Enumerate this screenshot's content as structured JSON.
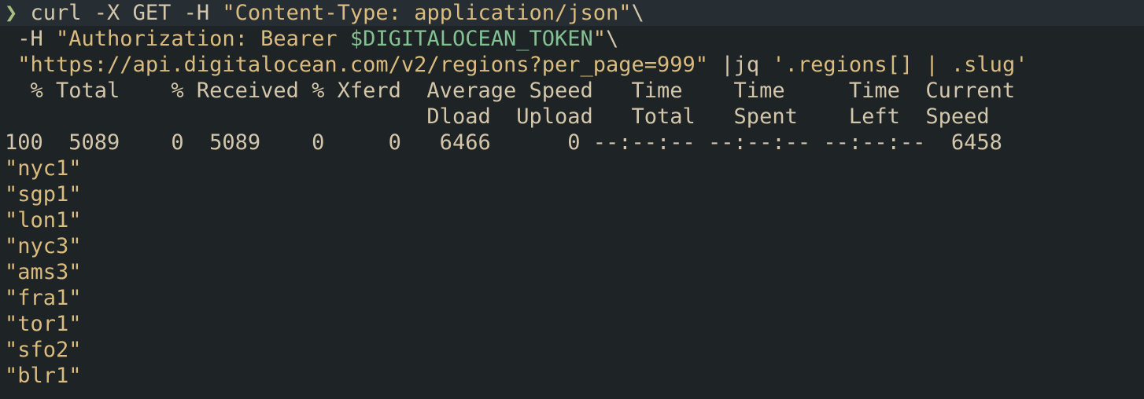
{
  "colors": {
    "background": "#1e2326",
    "command_highlight": "#272e33",
    "prompt": "#a7c080",
    "text": "#d3c6aa",
    "string": "#dbbc7f",
    "variable": "#83c092"
  },
  "command": {
    "prompt_symbol": "❯",
    "line1": {
      "cmd": " curl -X GET -H ",
      "str": "\"Content-Type: application/json\"",
      "tail": "\\"
    },
    "line2": {
      "lead": " -H ",
      "str_a": "\"Authorization: Bearer ",
      "var": "$DIGITALOCEAN_TOKEN",
      "str_b": "\"",
      "tail": "\\"
    },
    "line3": {
      "lead": " ",
      "url": "\"https://api.digitalocean.com/v2/regions?per_page=999\"",
      "pipe": " |jq ",
      "filter": "'.regions[] | .slug'"
    }
  },
  "progress": {
    "header1": "  % Total    % Received % Xferd  Average Speed   Time    Time     Time  Current",
    "header2": "                                 Dload  Upload   Total   Spent    Left  Speed",
    "row": "100  5089    0  5089    0     0   6466      0 --:--:-- --:--:-- --:--:--  6458"
  },
  "output": [
    "\"nyc1\"",
    "\"sgp1\"",
    "\"lon1\"",
    "\"nyc3\"",
    "\"ams3\"",
    "\"fra1\"",
    "\"tor1\"",
    "\"sfo2\"",
    "\"blr1\""
  ]
}
